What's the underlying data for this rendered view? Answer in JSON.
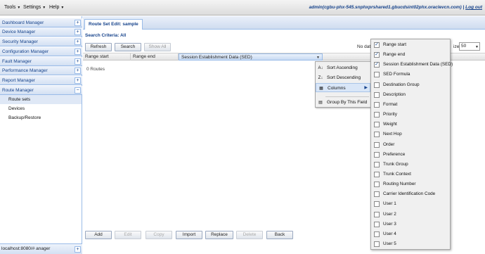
{
  "topbar": {
    "menus": [
      {
        "label": "Tools"
      },
      {
        "label": "Settings"
      },
      {
        "label": "Help"
      }
    ],
    "user": "admin(cgbu-phx-545.snphxprshared1.gbucdsint02phx.oraclevcn.com)",
    "separator": "|",
    "logout": "Log out"
  },
  "sidebar": {
    "sections": [
      {
        "label": "Dashboard Manager",
        "toggle": "+"
      },
      {
        "label": "Device Manager",
        "toggle": "+"
      },
      {
        "label": "Security Manager",
        "toggle": "+"
      },
      {
        "label": "Configuration Manager",
        "toggle": "+"
      },
      {
        "label": "Fault Manager",
        "toggle": "+"
      },
      {
        "label": "Performance Manager",
        "toggle": "+"
      },
      {
        "label": "Report Manager",
        "toggle": "+"
      },
      {
        "label": "Route Manager",
        "toggle": "−"
      }
    ],
    "route_items": [
      {
        "label": "Route sets",
        "selected": true
      },
      {
        "label": "Devices",
        "selected": false
      },
      {
        "label": "Backup/Restore",
        "selected": false
      }
    ],
    "status_url": "localhost:8080/#",
    "status_suffix": "anager",
    "status_toggle": "+"
  },
  "main": {
    "tab_title": "Route Set Edit: sample",
    "criteria": "Search Criteria: All",
    "toolbar": {
      "refresh": "Refresh",
      "search": "Search",
      "show_all": "Show All"
    },
    "no_data": "No data",
    "page_size_label": "ize",
    "page_size_value": "50",
    "columns": [
      "Range start",
      "Range end",
      "Session Establishment Data (SED)"
    ],
    "routes_count": "0 Routes",
    "bottom_buttons": {
      "add": "Add",
      "edit": "Edit",
      "copy": "Copy",
      "import": "Import",
      "replace": "Replace",
      "delete": "Delete",
      "back": "Back"
    }
  },
  "context_menu": {
    "sort_asc": "Sort Ascending",
    "sort_desc": "Sort Descending",
    "columns": "Columns",
    "group_by": "Group By This Field"
  },
  "columns_menu": [
    {
      "label": "Range start",
      "checked": true
    },
    {
      "label": "Range end",
      "checked": true
    },
    {
      "label": "Session Establishment Data (SED)",
      "checked": true
    },
    {
      "label": "SED Formula",
      "checked": false
    },
    {
      "label": "Destination Group",
      "checked": false
    },
    {
      "label": "Description",
      "checked": false
    },
    {
      "label": "Format",
      "checked": false
    },
    {
      "label": "Priority",
      "checked": false
    },
    {
      "label": "Weight",
      "checked": false
    },
    {
      "label": "Next Hop",
      "checked": false
    },
    {
      "label": "Order",
      "checked": false
    },
    {
      "label": "Preference",
      "checked": false
    },
    {
      "label": "Trunk Group",
      "checked": false
    },
    {
      "label": "Trunk Context",
      "checked": false
    },
    {
      "label": "Routing Number",
      "checked": false
    },
    {
      "label": "Carrier Identification Code",
      "checked": false
    },
    {
      "label": "User 1",
      "checked": false
    },
    {
      "label": "User 2",
      "checked": false
    },
    {
      "label": "User 3",
      "checked": false
    },
    {
      "label": "User 4",
      "checked": false
    },
    {
      "label": "User 5",
      "checked": false
    }
  ],
  "colors": {
    "accent": "#15428b",
    "header_border": "#99bbe8",
    "selected_row": "#dfe8f6"
  }
}
